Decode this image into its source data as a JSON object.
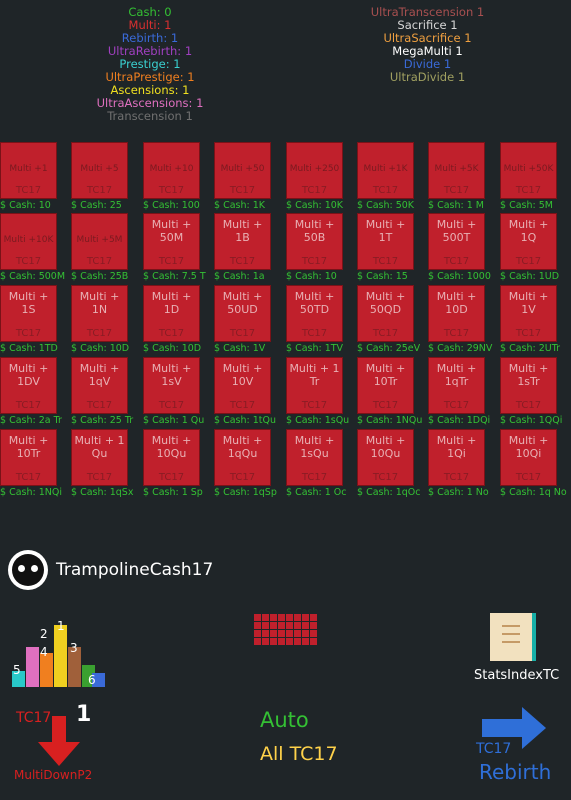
{
  "stats_left": [
    {
      "text": "Cash: 0",
      "color": "#34c034"
    },
    {
      "text": "Multi: 1",
      "color": "#d83030"
    },
    {
      "text": "Rebirth: 1",
      "color": "#3a6ad8"
    },
    {
      "text": "UltraRebirth: 1",
      "color": "#a040c0"
    },
    {
      "text": "Prestige: 1",
      "color": "#3ad0d0"
    },
    {
      "text": "UltraPrestige: 1",
      "color": "#f07f1f"
    },
    {
      "text": "Ascensions: 1",
      "color": "#f0e020"
    },
    {
      "text": "UltraAscensions: 1",
      "color": "#e070c0"
    },
    {
      "text": "Transcension 1",
      "color": "#707070"
    }
  ],
  "stats_right": [
    {
      "text": "UltraTranscension 1",
      "color": "#a85050"
    },
    {
      "text": "Sacrifice 1",
      "color": "#d8d8d8"
    },
    {
      "text": "UltraSacrifice 1",
      "color": "#f0a040"
    },
    {
      "text": "MegaMulti 1",
      "color": "#ffffff"
    },
    {
      "text": "Divide 1",
      "color": "#3a6ad8"
    },
    {
      "text": "UltraDivide 1",
      "color": "#a0a060"
    }
  ],
  "card_tag": "TC17",
  "upgrades": [
    {
      "label": "Multi +1",
      "cost": "$ Cash: 10",
      "small": true
    },
    {
      "label": "Multi +5",
      "cost": "$ Cash: 25",
      "small": true
    },
    {
      "label": "Multi +10",
      "cost": "$ Cash: 100",
      "small": true
    },
    {
      "label": "Multi +50",
      "cost": "$ Cash: 1K",
      "small": true
    },
    {
      "label": "Multi +250",
      "cost": "$ Cash: 10K",
      "small": true
    },
    {
      "label": "Multi +1K",
      "cost": "$ Cash: 50K",
      "small": true
    },
    {
      "label": "Multi +5K",
      "cost": "$ Cash: 1 M",
      "small": true
    },
    {
      "label": "Multi +50K",
      "cost": "$ Cash: 5M",
      "small": true
    },
    {
      "label": "Multi +10K",
      "cost": "$ Cash: 500M",
      "small": true
    },
    {
      "label": "Multi +5M",
      "cost": "$ Cash: 25B",
      "small": true
    },
    {
      "label": "Multi + 50M",
      "cost": "$ Cash: 7.5 T",
      "small": false
    },
    {
      "label": "Multi + 1B",
      "cost": "$ Cash: 1a",
      "small": false
    },
    {
      "label": "Multi + 50B",
      "cost": "$ Cash: 10",
      "small": false
    },
    {
      "label": "Multi + 1T",
      "cost": "$ Cash: 15",
      "small": false
    },
    {
      "label": "Multi + 500T",
      "cost": "$ Cash: 1000",
      "small": false
    },
    {
      "label": "Multi + 1Q",
      "cost": "$ Cash: 1UD",
      "small": false
    },
    {
      "label": "Multi + 1S",
      "cost": "$ Cash: 1TD",
      "small": false
    },
    {
      "label": "Multi + 1N",
      "cost": "$ Cash: 10D",
      "small": false
    },
    {
      "label": "Multi + 1D",
      "cost": "$ Cash: 10D",
      "small": false
    },
    {
      "label": "Multi + 50UD",
      "cost": "$ Cash: 1V",
      "small": false
    },
    {
      "label": "Multi + 50TD",
      "cost": "$ Cash: 1TV",
      "small": false
    },
    {
      "label": "Multi + 50QD",
      "cost": "$ Cash: 25eV",
      "small": false
    },
    {
      "label": "Multi + 10D",
      "cost": "$ Cash: 29NV",
      "small": false
    },
    {
      "label": "Multi + 1V",
      "cost": "$ Cash: 2UTr",
      "small": false
    },
    {
      "label": "Multi + 1DV",
      "cost": "$ Cash: 2a Tr",
      "small": false
    },
    {
      "label": "Multi + 1qV",
      "cost": "$ Cash: 25 Tr",
      "small": false
    },
    {
      "label": "Multi + 1sV",
      "cost": "$ Cash: 1 Qu",
      "small": false
    },
    {
      "label": "Multi + 10V",
      "cost": "$ Cash: 1tQu",
      "small": false
    },
    {
      "label": "Multi + 1 Tr",
      "cost": "$ Cash: 1sQu",
      "small": false
    },
    {
      "label": "Multi + 10Tr",
      "cost": "$ Cash: 1NQu",
      "small": false
    },
    {
      "label": "Multi + 1qTr",
      "cost": "$ Cash: 1DQi",
      "small": false
    },
    {
      "label": "Multi + 1sTr",
      "cost": "$ Cash: 1QQi",
      "small": false
    },
    {
      "label": "Multi + 10Tr",
      "cost": "$ Cash: 1NQi",
      "small": false
    },
    {
      "label": "Multi + 1 Qu",
      "cost": "$ Cash: 1qSx",
      "small": false
    },
    {
      "label": "Multi + 10Qu",
      "cost": "$ Cash: 1 Sp",
      "small": false
    },
    {
      "label": "Multi + 1qQu",
      "cost": "$ Cash: 1qSp",
      "small": false
    },
    {
      "label": "Multi + 1sQu",
      "cost": "$ Cash: 1 Oc",
      "small": false
    },
    {
      "label": "Multi + 10Qu",
      "cost": "$ Cash: 1qOc",
      "small": false
    },
    {
      "label": "Multi + 1Qi",
      "cost": "$ Cash: 1 No",
      "small": false
    },
    {
      "label": "Multi + 10Qi",
      "cost": "$ Cash: 1q No",
      "small": false
    }
  ],
  "profile": {
    "name": "TrampolineCash17"
  },
  "bar_digits": [
    "5",
    "4",
    "1",
    "2",
    "3",
    "6"
  ],
  "stats_index_label": "StatsIndexTC",
  "multidown": {
    "tag": "TC17",
    "digit": "1",
    "label": "MultiDownP2"
  },
  "auto": {
    "line1": "Auto",
    "line2": "All TC17"
  },
  "rebirth": {
    "tag": "TC17",
    "label": "Rebirth"
  }
}
